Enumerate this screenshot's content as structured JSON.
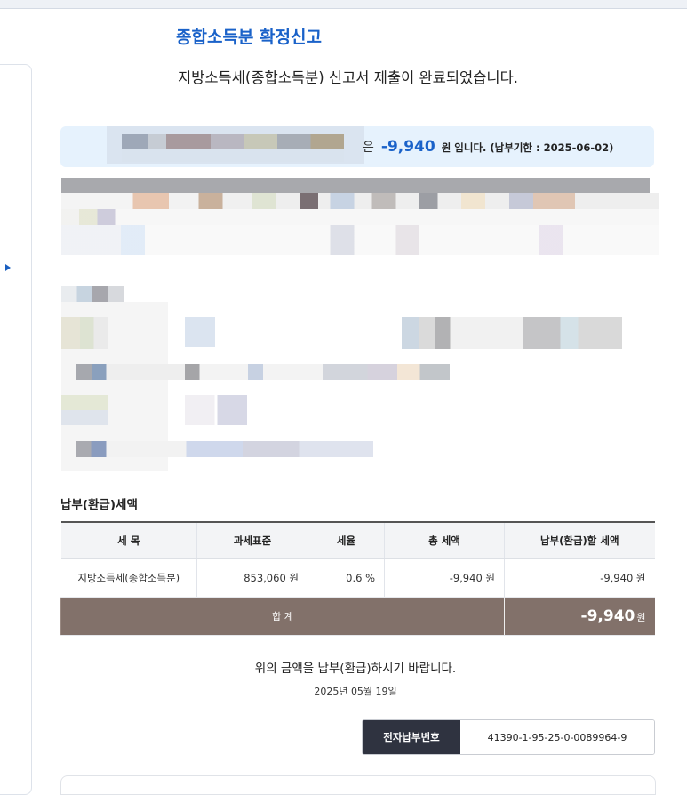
{
  "header": {
    "title": "종합소득분 확정신고",
    "subtitle": "지방소득세(종합소득분) 신고서 제출이 완료되었습니다."
  },
  "notice": {
    "suffix_particle": "은",
    "amount": "-9,940",
    "rest": "원 입니다. (납부기한 : 2025-06-02)"
  },
  "tax_section": {
    "title": "납부(환급)세액",
    "columns": [
      "세 목",
      "과세표준",
      "세율",
      "총 세액",
      "납부(환급)할 세액"
    ],
    "rows": [
      {
        "item": "지방소득세(종합소득분)",
        "base": "853,060 원",
        "rate": "0.6 %",
        "total": "-9,940 원",
        "payable": "-9,940 원"
      }
    ],
    "total_row": {
      "label": "합 계",
      "amount": "-9,940",
      "unit": "원"
    }
  },
  "closing": {
    "message": "위의 금액을 납부(환급)하시기 바랍니다.",
    "date": "2025년 05월 19일"
  },
  "payment": {
    "label": "전자납부번호",
    "number": "41390-1-95-25-0-0089964-9"
  },
  "colors": {
    "accent": "#1a62c9",
    "notice_bg": "#e6f2fd",
    "total_row_bg": "#82716a",
    "pay_label_bg": "#2f3340"
  }
}
